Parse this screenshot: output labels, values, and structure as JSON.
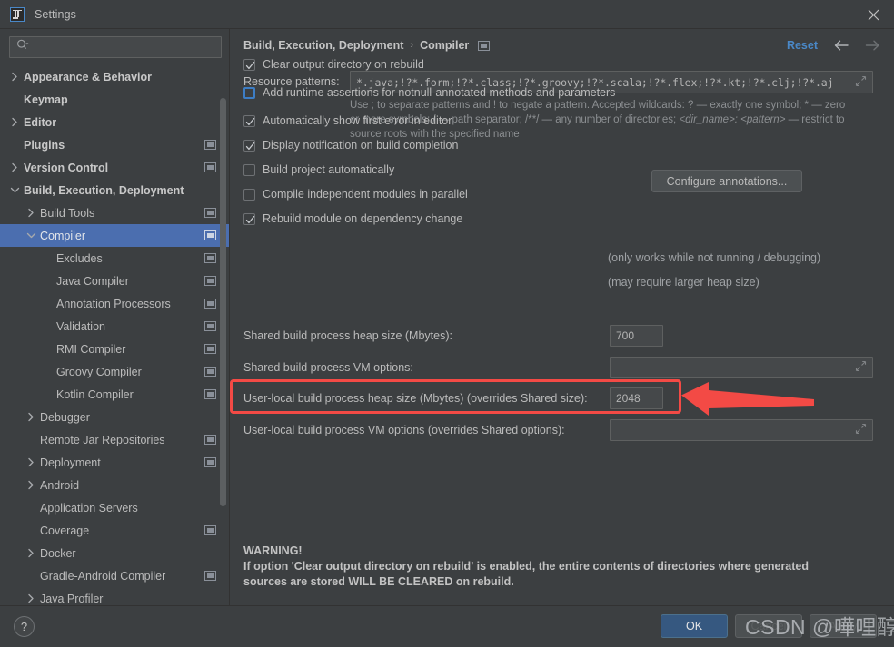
{
  "window": {
    "title": "Settings",
    "logo_icon": "intellij-idea-logo-icon",
    "close_icon": "close-icon"
  },
  "sidebar": {
    "search": {
      "value": "",
      "placeholder": "",
      "icon": "search-icon"
    },
    "items": [
      {
        "label": "Appearance & Behavior",
        "indent": 0,
        "twisty": "right",
        "bold": true,
        "module_icon": false,
        "selected": false
      },
      {
        "label": "Keymap",
        "indent": 0,
        "twisty": "none",
        "bold": true,
        "module_icon": false,
        "selected": false
      },
      {
        "label": "Editor",
        "indent": 0,
        "twisty": "right",
        "bold": true,
        "module_icon": false,
        "selected": false
      },
      {
        "label": "Plugins",
        "indent": 0,
        "twisty": "none",
        "bold": true,
        "module_icon": true,
        "selected": false
      },
      {
        "label": "Version Control",
        "indent": 0,
        "twisty": "right",
        "bold": true,
        "module_icon": true,
        "selected": false
      },
      {
        "label": "Build, Execution, Deployment",
        "indent": 0,
        "twisty": "down",
        "bold": true,
        "module_icon": false,
        "selected": false
      },
      {
        "label": "Build Tools",
        "indent": 1,
        "twisty": "right",
        "bold": false,
        "module_icon": true,
        "selected": false
      },
      {
        "label": "Compiler",
        "indent": 1,
        "twisty": "down",
        "bold": false,
        "module_icon": true,
        "selected": true
      },
      {
        "label": "Excludes",
        "indent": 2,
        "twisty": "none",
        "bold": false,
        "module_icon": true,
        "selected": false
      },
      {
        "label": "Java Compiler",
        "indent": 2,
        "twisty": "none",
        "bold": false,
        "module_icon": true,
        "selected": false
      },
      {
        "label": "Annotation Processors",
        "indent": 2,
        "twisty": "none",
        "bold": false,
        "module_icon": true,
        "selected": false
      },
      {
        "label": "Validation",
        "indent": 2,
        "twisty": "none",
        "bold": false,
        "module_icon": true,
        "selected": false
      },
      {
        "label": "RMI Compiler",
        "indent": 2,
        "twisty": "none",
        "bold": false,
        "module_icon": true,
        "selected": false
      },
      {
        "label": "Groovy Compiler",
        "indent": 2,
        "twisty": "none",
        "bold": false,
        "module_icon": true,
        "selected": false
      },
      {
        "label": "Kotlin Compiler",
        "indent": 2,
        "twisty": "none",
        "bold": false,
        "module_icon": true,
        "selected": false
      },
      {
        "label": "Debugger",
        "indent": 1,
        "twisty": "right",
        "bold": false,
        "module_icon": false,
        "selected": false
      },
      {
        "label": "Remote Jar Repositories",
        "indent": 1,
        "twisty": "none",
        "bold": false,
        "module_icon": true,
        "selected": false
      },
      {
        "label": "Deployment",
        "indent": 1,
        "twisty": "right",
        "bold": false,
        "module_icon": true,
        "selected": false
      },
      {
        "label": "Android",
        "indent": 1,
        "twisty": "right",
        "bold": false,
        "module_icon": false,
        "selected": false
      },
      {
        "label": "Application Servers",
        "indent": 1,
        "twisty": "none",
        "bold": false,
        "module_icon": false,
        "selected": false
      },
      {
        "label": "Coverage",
        "indent": 1,
        "twisty": "none",
        "bold": false,
        "module_icon": true,
        "selected": false
      },
      {
        "label": "Docker",
        "indent": 1,
        "twisty": "right",
        "bold": false,
        "module_icon": false,
        "selected": false
      },
      {
        "label": "Gradle-Android Compiler",
        "indent": 1,
        "twisty": "none",
        "bold": false,
        "module_icon": true,
        "selected": false
      },
      {
        "label": "Java Profiler",
        "indent": 1,
        "twisty": "right",
        "bold": false,
        "module_icon": false,
        "selected": false
      }
    ]
  },
  "header": {
    "breadcrumb_root": "Build, Execution, Deployment",
    "breadcrumb_separator": "›",
    "breadcrumb_leaf": "Compiler",
    "leaf_module_icon": "module-scope-icon",
    "reset_label": "Reset",
    "back_icon": "arrow-left-icon",
    "forward_icon": "arrow-right-icon"
  },
  "main": {
    "resource_patterns": {
      "label": "Resource patterns:",
      "value": "*.java;!?*.form;!?*.class;!?*.groovy;!?*.scala;!?*.flex;!?*.kt;!?*.clj;!?*.aj",
      "expand_icon": "expand-icon"
    },
    "hint": "Use ; to separate patterns and ! to negate a pattern. Accepted wildcards: ? — exactly one symbol; * — zero or more symbols; / — path separator; /**/ — any number of directories;  <dir_name>: <pattern> — restrict to source roots with the specified name",
    "hint_line1": "Use ; to separate patterns and ! to negate a pattern. Accepted wildcards: ? — exactly one symbol; * — zero",
    "hint_line2a": "or more symbols; / — path separator; /**/ — any number of directories;  ",
    "hint_line2b": "<dir_name>: <pattern>",
    "hint_line2c": " — restrict to",
    "hint_line3": "source roots with the specified name",
    "checkboxes": [
      {
        "label": "Clear output directory on rebuild",
        "checked": true,
        "focused": false
      },
      {
        "label": "Add runtime assertions for notnull-annotated methods and parameters",
        "checked": false,
        "focused": true
      },
      {
        "label": "Automatically show first error in editor",
        "checked": true,
        "focused": false
      },
      {
        "label": "Display notification on build completion",
        "checked": true,
        "focused": false
      },
      {
        "label": "Build project automatically",
        "checked": false,
        "focused": false
      },
      {
        "label": "Compile independent modules in parallel",
        "checked": false,
        "focused": false
      },
      {
        "label": "Rebuild module on dependency change",
        "checked": true,
        "focused": false
      }
    ],
    "configure_annotations_button": "Configure annotations...",
    "note_build_project": "(only works while not running / debugging)",
    "note_parallel": "(may require larger heap size)",
    "fields": [
      {
        "label": "Shared build process heap size (Mbytes):",
        "value": "700",
        "wide": false,
        "expandable": false
      },
      {
        "label": "Shared build process VM options:",
        "value": "",
        "wide": true,
        "expandable": true
      },
      {
        "label": "User-local build process heap size (Mbytes) (overrides Shared size):",
        "value": "2048",
        "wide": false,
        "expandable": false
      },
      {
        "label": "User-local build process VM options (overrides Shared options):",
        "value": "",
        "wide": true,
        "expandable": true
      }
    ],
    "warning_title": "WARNING!",
    "warning_line1": "If option 'Clear output directory on rebuild' is enabled, the entire contents of directories where generated",
    "warning_line2": "sources are stored WILL BE CLEARED on rebuild."
  },
  "footer": {
    "help_label": "?",
    "ok_label": "OK",
    "cancel_label": "Cancel",
    "apply_label": "Apply"
  },
  "annotations": {
    "highlight_color": "#f34a45",
    "highlight_target": "User-local build process heap size (Mbytes) (overrides Shared size):",
    "arrow_icon": "left-arrow-annotation-icon",
    "watermark_text": "CSDN @嘩哩醇啦"
  },
  "colors": {
    "background": "#3c3f41",
    "selection": "#4b6eaf",
    "accent_link": "#4a88c7",
    "ok_button": "#365880",
    "annotation_red": "#f34a45"
  }
}
